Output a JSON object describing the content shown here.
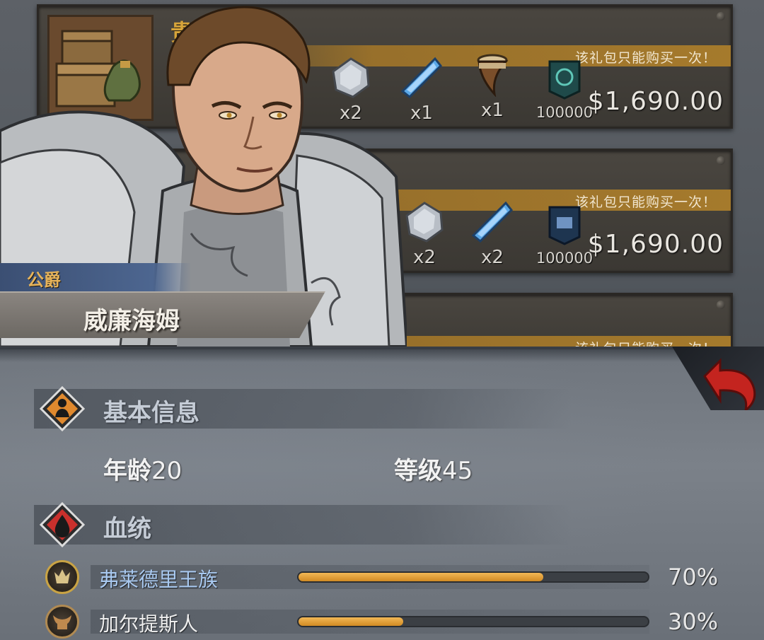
{
  "shop": {
    "packs": [
      {
        "title": "贵族的誓约",
        "banner": "该礼包只能购买一次！",
        "price": "$1,690.00",
        "items": [
          {
            "icon": "ore-stone-icon",
            "qty": "x2"
          },
          {
            "icon": "blue-crystal-icon",
            "qty": "x1"
          },
          {
            "icon": "horn-icon",
            "qty": "x1"
          },
          {
            "icon": "banner-icon",
            "qty": "100000"
          }
        ]
      },
      {
        "banner": "该礼包只能购买一次！",
        "price": "$1,690.00",
        "items": [
          {
            "icon": "ore-stone-icon",
            "qty": "x2"
          },
          {
            "icon": "blue-crystal-icon",
            "qty": "x2"
          },
          {
            "icon": "banner-icon",
            "qty": "100000"
          }
        ]
      },
      {
        "banner": "该礼包只能购买一次！"
      }
    ]
  },
  "character": {
    "title": "公爵",
    "name": "威廉海姆"
  },
  "basic_info": {
    "section_title": "基本信息",
    "age_label": "年龄",
    "age": "20",
    "level_label": "等级",
    "level": "45"
  },
  "bloodline": {
    "section_title": "血统",
    "entries": [
      {
        "name": "弗莱德里王族",
        "percent": 70,
        "percent_text": "70%"
      },
      {
        "name": "加尔提斯人",
        "percent": 30,
        "percent_text": "30%"
      }
    ]
  },
  "colors": {
    "accent_gold": "#d6a43a",
    "bar_fill": "#e0a03a",
    "back_arrow": "#c4241f",
    "info_diamond": "#e0892e",
    "bloodline_diamond": "#c9302c"
  }
}
